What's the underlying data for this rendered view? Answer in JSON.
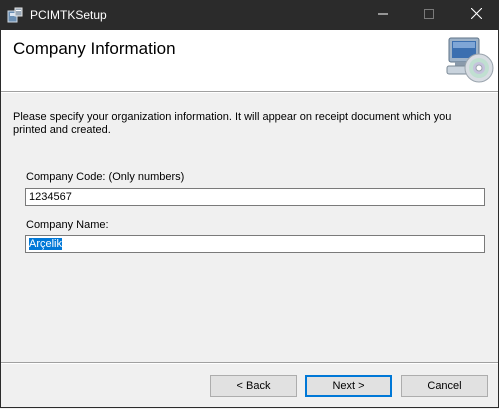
{
  "window": {
    "title": "PCIMTKSetup"
  },
  "banner": {
    "title": "Company Information"
  },
  "description": "Please specify your organization information. It will appear on receipt document which you printed and created.",
  "form": {
    "company_code_label": "Company Code: (Only numbers)",
    "company_code_value": "1234567",
    "company_name_label": "Company Name:",
    "company_name_value": "Arçelik"
  },
  "buttons": {
    "back": "< Back",
    "next": "Next >",
    "cancel": "Cancel"
  },
  "icons": {
    "app": "setup-app-icon",
    "banner": "computer-cd-icon",
    "minimize": "minimize-icon",
    "maximize": "maximize-icon",
    "close": "close-icon"
  }
}
